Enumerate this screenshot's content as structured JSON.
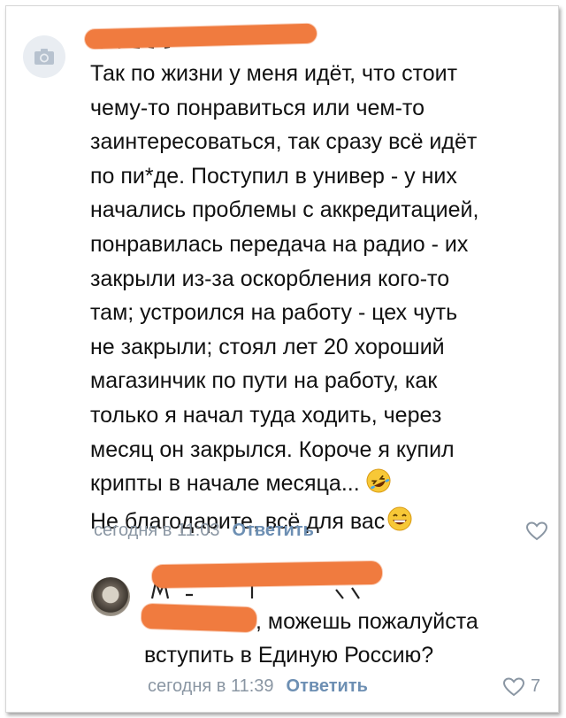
{
  "comment": {
    "lines": [
      "Так по жизни у меня идёт, что стоит",
      "чему-то понравиться или чем-то",
      "заинтересоваться, так сразу всё идёт",
      "по пи*де. Поступил в универ - у них",
      "начались проблемы с аккредитацией,",
      "понравилась передача на радио - их",
      "закрыли из-за оскорбления кого-то",
      "там; устроился на работу - цех чуть",
      "не закрыли; стоял лет 20 хороший",
      "магазинчик по пути на работу, как",
      "только я начал туда ходить, через",
      "месяц он закрылся. Короче я купил",
      "крипты в начале месяца...",
      "Не благодарите, всё для вас"
    ],
    "timestamp": "сегодня в 11:03",
    "reply_label": "Ответить",
    "emoji_1": "rolling-on-floor-laughing-emoji",
    "emoji_2": "grinning-face-emoji"
  },
  "reply": {
    "lines": [
      ", можешь пожалуйста",
      "вступить в Единую Россию?"
    ],
    "timestamp": "сегодня в 11:39",
    "reply_label": "Ответить",
    "likes": "7"
  },
  "colors": {
    "redaction": "#f07b3f",
    "meta_gray": "#8a96a3",
    "link_blue": "#6d8fb3"
  }
}
